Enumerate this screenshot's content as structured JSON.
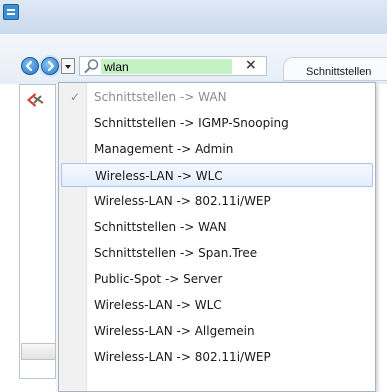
{
  "search": {
    "value": "wlan"
  },
  "tab": {
    "label": "Schnittstellen"
  },
  "menu": {
    "items": [
      {
        "label": "Schnittstellen -> WAN",
        "state": "checked-disabled"
      },
      {
        "label": "Schnittstellen -> IGMP-Snooping"
      },
      {
        "label": "Management -> Admin"
      },
      {
        "label": "Wireless-LAN -> WLC",
        "state": "highlighted"
      },
      {
        "label": "Wireless-LAN -> 802.11i/WEP"
      },
      {
        "label": "Schnittstellen -> WAN"
      },
      {
        "label": "Schnittstellen -> Span.Tree"
      },
      {
        "label": "Public-Spot -> Server"
      },
      {
        "label": "Wireless-LAN -> WLC"
      },
      {
        "label": "Wireless-LAN -> Allgemein"
      },
      {
        "label": "Wireless-LAN -> 802.11i/WEP"
      }
    ]
  },
  "colors": {
    "search_highlight": "#c5f2c5",
    "item_highlight": "#e4eefb"
  },
  "icons": [
    "app-icon",
    "back-arrow-icon",
    "forward-arrow-icon",
    "chevron-down-icon",
    "search-icon",
    "close-icon",
    "tree-config-icon",
    "checkmark-icon"
  ]
}
